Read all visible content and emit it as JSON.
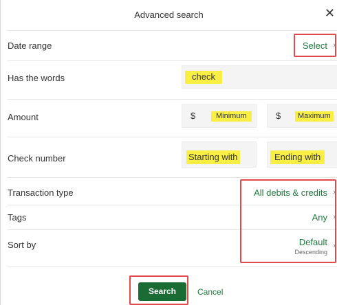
{
  "dialog": {
    "title": "Advanced search",
    "close_glyph": "✕"
  },
  "date_range": {
    "label": "Date range",
    "value": "Select"
  },
  "words": {
    "label": "Has the words",
    "value": "check"
  },
  "amount": {
    "label": "Amount",
    "currency": "$",
    "min_placeholder": "Minimum",
    "max_placeholder": "Maximum"
  },
  "check_number": {
    "label": "Check number",
    "start_placeholder": "Starting with",
    "end_placeholder": "Ending with"
  },
  "transaction_type": {
    "label": "Transaction type",
    "value": "All debits & credits"
  },
  "tags": {
    "label": "Tags",
    "value": "Any"
  },
  "sort_by": {
    "label": "Sort by",
    "value": "Default",
    "subvalue": "Descending"
  },
  "actions": {
    "search": "Search",
    "cancel": "Cancel"
  },
  "icons": {
    "chevron": "›"
  },
  "colors": {
    "accent": "#1e7a3c",
    "button": "#1b6b34",
    "highlight": "#f9ef44",
    "annotation": "#e04a4a"
  }
}
